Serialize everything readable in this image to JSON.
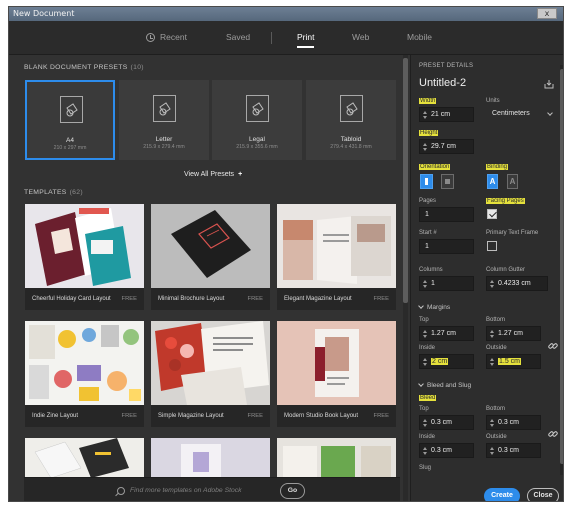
{
  "window": {
    "title": "New Document",
    "close_label": "x"
  },
  "nav": {
    "tabs": [
      {
        "label": "Recent"
      },
      {
        "label": "Saved"
      },
      {
        "label": "Print"
      },
      {
        "label": "Web"
      },
      {
        "label": "Mobile"
      }
    ],
    "active": "Print"
  },
  "presets_section": {
    "title": "BLANK DOCUMENT PRESETS",
    "count": "(10)"
  },
  "presets": [
    {
      "name": "A4",
      "size": "210 x 297 mm",
      "selected": true
    },
    {
      "name": "Letter",
      "size": "215.9 x 279.4 mm",
      "selected": false
    },
    {
      "name": "Legal",
      "size": "215.9 x 355.6 mm",
      "selected": false
    },
    {
      "name": "Tabloid",
      "size": "279.4 x 431.8 mm",
      "selected": false
    }
  ],
  "view_all_presets": "View All Presets",
  "templates_section": {
    "title": "TEMPLATES",
    "count": "(62)"
  },
  "templates": [
    {
      "name": "Cheerful Holiday Card Layout",
      "price": "FREE"
    },
    {
      "name": "Minimal Brochure Layout",
      "price": "FREE"
    },
    {
      "name": "Elegant Magazine Layout",
      "price": "FREE"
    },
    {
      "name": "Indie Zine Layout",
      "price": "FREE"
    },
    {
      "name": "Simple Magazine Layout",
      "price": "FREE"
    },
    {
      "name": "Modern Studio Book Layout",
      "price": "FREE"
    }
  ],
  "search": {
    "placeholder": "Find more templates on Adobe Stock",
    "go_label": "Go"
  },
  "details": {
    "header": "PRESET DETAILS",
    "doc_name": "Untitled-2",
    "width_label": "Width",
    "width_value": "21 cm",
    "units_label": "Units",
    "units_value": "Centimeters",
    "height_label": "Height",
    "height_value": "29.7 cm",
    "orientation_label": "Orientation",
    "binding_label": "Binding",
    "binding_left": "A",
    "binding_right": "A",
    "pages_label": "Pages",
    "pages_value": "1",
    "facing_label": "Facing Pages",
    "facing_checked": true,
    "start_label": "Start #",
    "start_value": "1",
    "ptf_label": "Primary Text Frame",
    "ptf_checked": false,
    "columns_label": "Columns",
    "columns_value": "1",
    "gutter_label": "Column Gutter",
    "gutter_value": "0.4233 cm",
    "margins": {
      "header": "Margins",
      "top_label": "Top",
      "top_value": "1.27 cm",
      "bottom_label": "Bottom",
      "bottom_value": "1.27 cm",
      "inside_label": "Inside",
      "inside_value": "2 cm",
      "outside_label": "Outside",
      "outside_value": "1.5 cm"
    },
    "bleed": {
      "header": "Bleed and Slug",
      "bleed_label": "Bleed",
      "top_label": "Top",
      "top_value": "0.3 cm",
      "bottom_label": "Bottom",
      "bottom_value": "0.3 cm",
      "inside_label": "Inside",
      "inside_value": "0.3 cm",
      "outside_label": "Outside",
      "outside_value": "0.3 cm",
      "slug_label": "Slug"
    },
    "create_label": "Create",
    "close_label": "Close"
  },
  "colors": {
    "accent": "#2d8ceb",
    "highlight": "#e5e13c",
    "panel": "#323232"
  }
}
